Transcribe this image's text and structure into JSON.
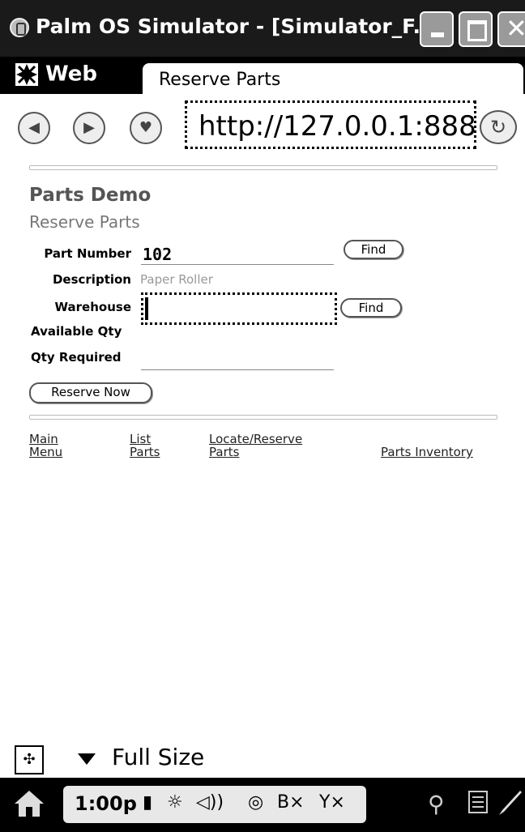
{
  "window": {
    "title": "Palm OS Simulator - [Simulator_F...",
    "buttons": [
      "minimize",
      "maximize",
      "close"
    ],
    "close_glyph": "✕"
  },
  "tabs": {
    "app_label": "Web",
    "page_tab_label": "Reserve Parts"
  },
  "nav": {
    "back_icon": "back-arrow-icon",
    "back_glyph": "◀",
    "forward_icon": "forward-arrow-icon",
    "forward_glyph": "▶",
    "favorite_icon": "heart-icon",
    "favorite_glyph": "♥",
    "url": "http://127.0.0.1:888",
    "reload_icon": "reload-icon",
    "reload_glyph": "↻"
  },
  "page": {
    "title": "Parts Demo",
    "subtitle": "Reserve Parts",
    "form": {
      "part_number_label": "Part Number",
      "part_number_value": "102",
      "find_label": "Find",
      "description_label": "Description",
      "description_value": "Paper Roller",
      "warehouse_label": "Warehouse",
      "warehouse_value": "",
      "warehouse_find_label": "Find",
      "available_qty_label": "Available Qty",
      "qty_required_label": "Qty Required",
      "qty_required_value": "",
      "reserve_button_label": "Reserve Now"
    },
    "links": [
      {
        "line1": "Main",
        "line2": "Menu"
      },
      {
        "line1": "List",
        "line2": "Parts"
      },
      {
        "line1": "Locate/Reserve",
        "line2": "Parts"
      },
      {
        "line1": "Parts Inventory",
        "line2": ""
      }
    ]
  },
  "bottom": {
    "move_glyph": "✣",
    "full_size_label": "Full Size",
    "time": "1:00p",
    "status_glyphs": {
      "battery": "▮",
      "brightness": "☼",
      "volume": "◁))",
      "network": "◎",
      "bluetooth": "B×",
      "antenna": "Y×"
    },
    "search_glyph": "⚲"
  }
}
